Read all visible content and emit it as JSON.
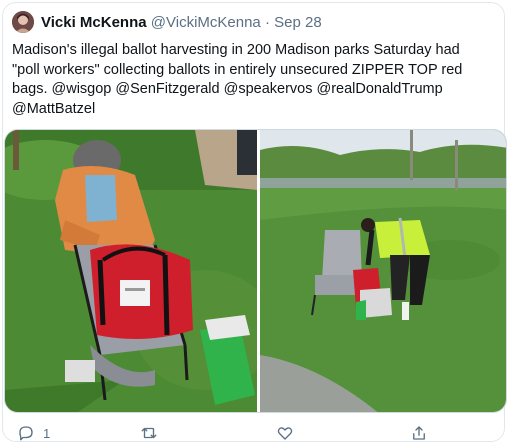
{
  "tweet": {
    "author_name": "Vicki McKenna",
    "author_handle": "@VickiMcKenna",
    "separator": "·",
    "date": "Sep 28",
    "text_line_1": "Madison's illegal ballot harvesting in 200 Madison parks Saturday had",
    "text_line_2": "\"poll workers\" collecting ballots in entirely unsecured ZIPPER TOP red",
    "text_line_3": "bags.  @wisgop @SenFitzgerald @speakervos @realDonaldTrump",
    "text_line_4": "@MattBatzel"
  },
  "actions": {
    "reply_count": "1",
    "reply_icon": "reply-icon",
    "retweet_icon": "retweet-icon",
    "like_icon": "heart-icon",
    "share_icon": "share-icon"
  },
  "colors": {
    "text": "#0f1419",
    "secondary": "#5b7083",
    "grass": "#4a8a33",
    "bag_red": "#d01f2c",
    "vest": "#c8f03a"
  }
}
